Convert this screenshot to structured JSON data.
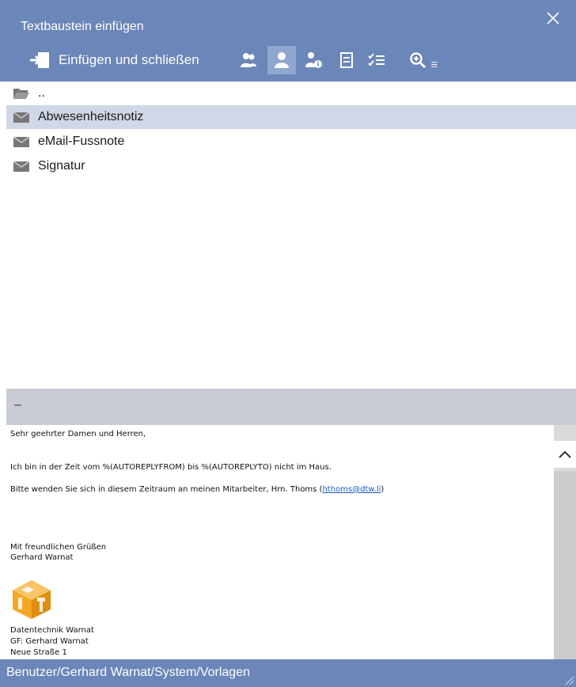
{
  "window": {
    "title": "Textbaustein einfügen"
  },
  "toolbar": {
    "insert_close_label": "Einfügen und schließen",
    "icons": [
      "users-icon",
      "user-icon",
      "user-info-icon",
      "document-list-icon",
      "checklist-icon",
      "zoom-icon"
    ]
  },
  "list": {
    "items": [
      {
        "label": "..",
        "icon": "folder-open-icon",
        "selected": false
      },
      {
        "label": "Abwesenheitsnotiz",
        "icon": "envelope-icon",
        "selected": true
      },
      {
        "label": "eMail-Fussnote",
        "icon": "envelope-icon",
        "selected": false
      },
      {
        "label": "Signatur",
        "icon": "envelope-icon",
        "selected": false
      }
    ]
  },
  "divider": {
    "label": "–"
  },
  "preview": {
    "greeting": "Sehr geehrter Damen und Herren,",
    "line1": "Ich bin in der Zeit vom %(AUTOREPLYFROM) bis %(AUTOREPLYTO) nicht im Haus.",
    "line2_prefix": "Bitte wenden Sie sich in diesem Zeitraum an meinen Mitarbeiter, Hrn. Thoms (",
    "line2_link": "hthoms@dtw.li",
    "line2_suffix": ")",
    "closing": "Mit freundlichen Grüßen",
    "name": "Gerhard Warnat",
    "company": "Datentechnik Warnat",
    "gf": "GF: Gerhard Warnat",
    "street": "Neue Straße 1"
  },
  "status": {
    "path": "Benutzer/Gerhard Warnat/System/Vorlagen"
  },
  "colors": {
    "accent": "#6b86b8",
    "selected_row": "#d0d7e6",
    "active_tool": "#8fa6cf",
    "link": "#1a5cc8",
    "logo": "#f5a623"
  }
}
